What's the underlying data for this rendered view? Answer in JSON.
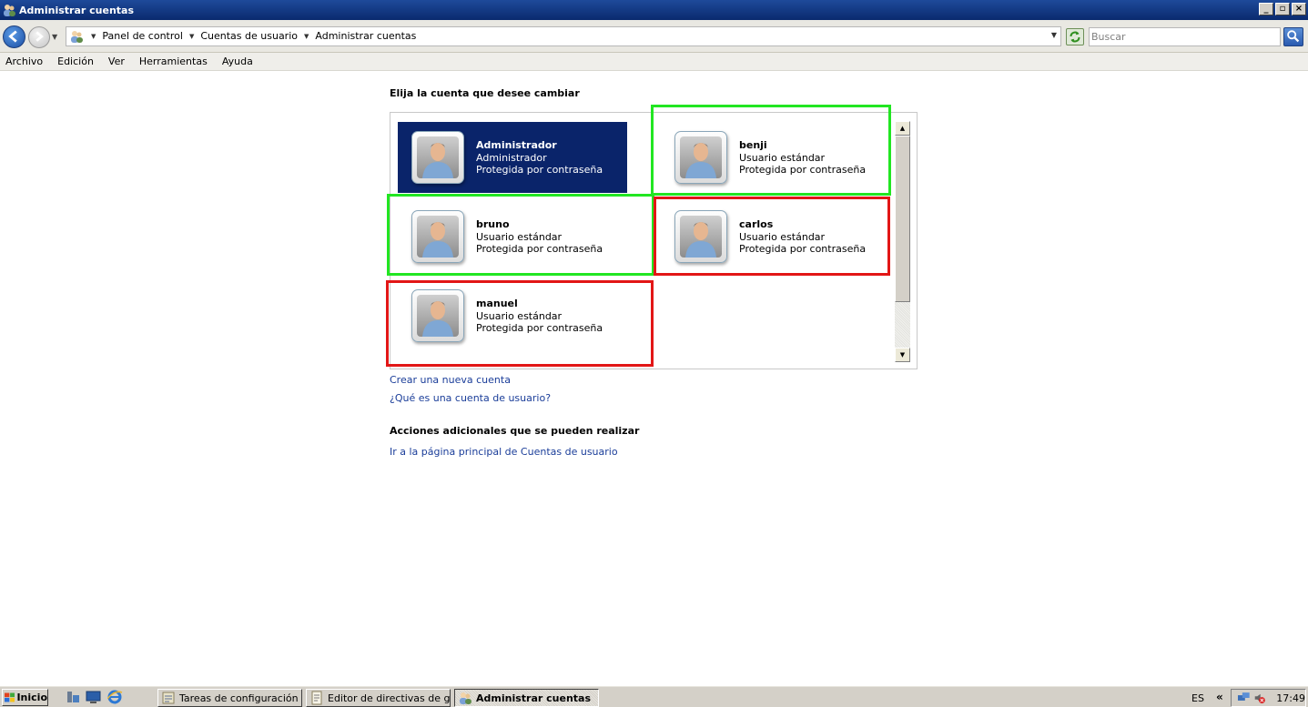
{
  "window": {
    "title": "Administrar cuentas"
  },
  "address": {
    "crumbs": [
      "Panel de control",
      "Cuentas de usuario",
      "Administrar cuentas"
    ],
    "search_placeholder": "Buscar"
  },
  "menu": [
    "Archivo",
    "Edición",
    "Ver",
    "Herramientas",
    "Ayuda"
  ],
  "main": {
    "heading": "Elija la cuenta que desee cambiar",
    "accounts": [
      {
        "name": "Administrador",
        "type": "Administrador",
        "protection": "Protegida por contraseña"
      },
      {
        "name": "benji",
        "type": "Usuario estándar",
        "protection": "Protegida por contraseña"
      },
      {
        "name": "bruno",
        "type": "Usuario estándar",
        "protection": "Protegida por contraseña"
      },
      {
        "name": "carlos",
        "type": "Usuario estándar",
        "protection": "Protegida por contraseña"
      },
      {
        "name": "manuel",
        "type": "Usuario estándar",
        "protection": "Protegida por contraseña"
      }
    ],
    "links": [
      "Crear una nueva cuenta",
      "¿Qué es una cuenta de usuario?"
    ],
    "additional_heading": "Acciones adicionales que se pueden realizar",
    "additional_links": [
      "Ir a la página principal de Cuentas de usuario"
    ]
  },
  "colors": {
    "selected_tile": "#0a246a",
    "highlight_green": "#22e622",
    "highlight_red": "#e21616",
    "link": "#1a3d99"
  },
  "taskbar": {
    "start_label": "Inicio",
    "tasks": [
      "Tareas de configuración i...",
      "Editor de directivas de gr...",
      "Administrar cuentas"
    ],
    "language": "ES",
    "chevron": "«",
    "clock": "17:49"
  }
}
